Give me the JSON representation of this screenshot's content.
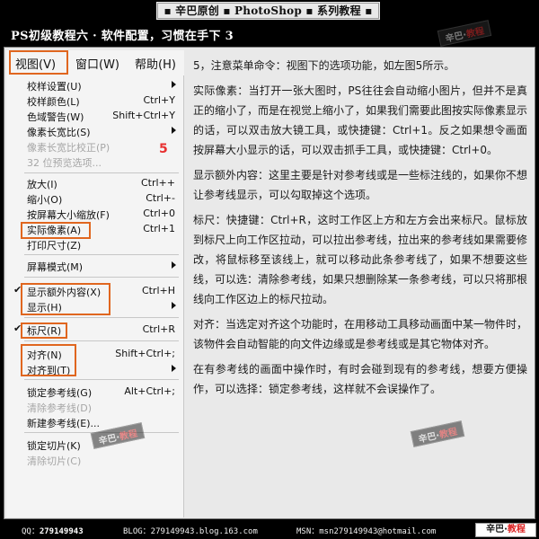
{
  "banner": {
    "title": "▪ 辛巴原创 ▪ PhotoShop ▪ 系列教程 ▪"
  },
  "header": {
    "title": "PS初级教程六 · 软件配置，习惯在手下 3",
    "stamp_text": "辛巴·",
    "stamp_red": "教程"
  },
  "menubar": {
    "view": "视图(V)",
    "window": "窗口(W)",
    "help": "帮助(H)"
  },
  "menu": {
    "items": [
      {
        "label": "校样设置(U)",
        "shortcut": "",
        "submenu": true,
        "disabled": false
      },
      {
        "label": "校样颜色(L)",
        "shortcut": "Ctrl+Y",
        "disabled": false
      },
      {
        "label": "色域警告(W)",
        "shortcut": "Shift+Ctrl+Y",
        "disabled": false
      },
      {
        "label": "像素长宽比(S)",
        "shortcut": "",
        "submenu": true,
        "disabled": false
      },
      {
        "label": "像素长宽比校正(P)",
        "shortcut": "",
        "disabled": true
      },
      {
        "label": "32 位预览选项...",
        "shortcut": "",
        "disabled": true
      },
      {
        "label": "放大(I)",
        "shortcut": "Ctrl++",
        "disabled": false
      },
      {
        "label": "缩小(O)",
        "shortcut": "Ctrl+-",
        "disabled": false
      },
      {
        "label": "按屏幕大小缩放(F)",
        "shortcut": "Ctrl+0",
        "disabled": false
      },
      {
        "label": "实际像素(A)",
        "shortcut": "Ctrl+1",
        "disabled": false
      },
      {
        "label": "打印尺寸(Z)",
        "shortcut": "",
        "disabled": false
      },
      {
        "label": "屏幕模式(M)",
        "shortcut": "",
        "submenu": true,
        "disabled": false
      },
      {
        "label": "显示额外内容(X)",
        "shortcut": "Ctrl+H",
        "checked": true,
        "disabled": false
      },
      {
        "label": "显示(H)",
        "shortcut": "",
        "submenu": true,
        "disabled": false
      },
      {
        "label": "标尺(R)",
        "shortcut": "Ctrl+R",
        "checked": true,
        "disabled": false
      },
      {
        "label": "对齐(N)",
        "shortcut": "Shift+Ctrl+;",
        "disabled": false
      },
      {
        "label": "对齐到(T)",
        "shortcut": "",
        "submenu": true,
        "disabled": false
      },
      {
        "label": "锁定参考线(G)",
        "shortcut": "Alt+Ctrl+;",
        "disabled": false
      },
      {
        "label": "清除参考线(D)",
        "shortcut": "",
        "disabled": true
      },
      {
        "label": "新建参考线(E)...",
        "shortcut": "",
        "disabled": false
      },
      {
        "label": "锁定切片(K)",
        "shortcut": "",
        "disabled": false
      },
      {
        "label": "清除切片(C)",
        "shortcut": "",
        "disabled": true
      }
    ],
    "annotation_number": "5",
    "stamp_text": "辛巴·",
    "stamp_red": "教程"
  },
  "content": {
    "paragraphs": [
      "5，注意菜单命令：视图下的选项功能，如左图5所示。",
      "实际像素：当打开一张大图时，PS往往会自动缩小图片，但并不是真正的缩小了，而是在视觉上缩小了，如果我们需要此图按实际像素显示的话，可以双击放大镜工具，或快捷键：Ctrl+1。反之如果想令画面按屏幕大小显示的话，可以双击抓手工具，或快捷键：Ctrl+0。",
      "显示额外内容：这里主要是针对参考线或是一些标注线的，如果你不想让参考线显示，可以勾取掉这个选项。",
      "标尺：快捷键：Ctrl+R，这时工作区上方和左方会出来标尺。鼠标放到标尺上向工作区拉动，可以拉出参考线，拉出来的参考线如果需要修改，将鼠标移至该线上，就可以移动此条参考线了，如果不想要这些线，可以选：清除参考线，如果只想删除某一条参考线，可以只将那根线向工作区边上的标尺拉动。",
      "对齐：当选定对齐这个功能时，在用移动工具移动画面中某一物件时，该物件会自动智能的向文件边缘或是参考线或是其它物体对齐。",
      "在有参考线的画面中操作时，有时会碰到现有的参考线，想要方便操作，可以选择：锁定参考线，这样就不会误操作了。"
    ],
    "stamp_text": "辛巴·",
    "stamp_red": "教程"
  },
  "footer": {
    "qq_label": "QQ：",
    "qq_value": "279149943",
    "blog": "BLOG：279149943.blog.163.com",
    "msn": "MSN：msn279149943@hotmail.com",
    "logo_text": "辛巴·",
    "logo_red": "教程"
  },
  "colors": {
    "highlight_box": "#e0661f",
    "annotation": "#e83030",
    "background": "#000000",
    "panel": "#e9e9e9"
  }
}
